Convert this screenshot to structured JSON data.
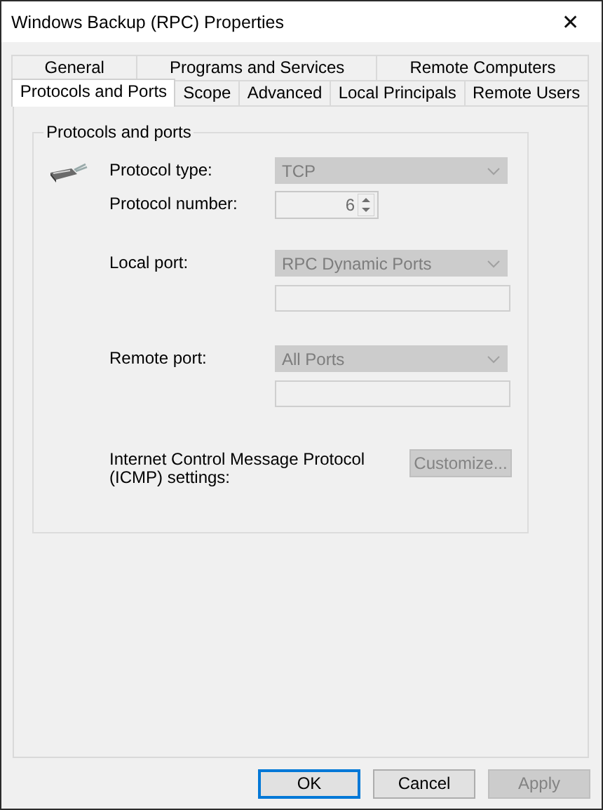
{
  "window": {
    "title": "Windows Backup (RPC) Properties",
    "close": "✕"
  },
  "tab_rows": [
    [
      {
        "label": "General",
        "selected": false
      },
      {
        "label": "Programs and Services",
        "selected": false
      },
      {
        "label": "Remote Computers",
        "selected": false
      }
    ],
    [
      {
        "label": "Protocols and Ports",
        "selected": true
      },
      {
        "label": "Scope",
        "selected": false
      },
      {
        "label": "Advanced",
        "selected": false
      },
      {
        "label": "Local Principals",
        "selected": false
      },
      {
        "label": "Remote Users",
        "selected": false
      }
    ]
  ],
  "group": {
    "title": "Protocols and ports",
    "rows": [
      {
        "label": "Protocol type:",
        "control": {
          "kind": "dropdown",
          "value": "TCP",
          "disabled": true
        }
      },
      {
        "label": "Protocol number:",
        "control": {
          "kind": "spin",
          "value": "6",
          "disabled": true
        }
      },
      {
        "label": "Local port:",
        "control": {
          "kind": "dropdown",
          "value": "RPC Dynamic Ports",
          "disabled": true
        },
        "port_box": {
          "disabled": true
        }
      },
      {
        "label": "Remote port:",
        "control": {
          "kind": "dropdown",
          "value": "All Ports",
          "disabled": true
        },
        "port_box": {
          "disabled": true
        }
      },
      {
        "label": "Internet Control Message Protocol (ICMP) settings:",
        "control": {
          "kind": "button",
          "value": "Customize...",
          "disabled": true
        }
      }
    ]
  },
  "buttons": [
    {
      "label": "OK",
      "default": true,
      "disabled": false
    },
    {
      "label": "Cancel",
      "default": false,
      "disabled": false
    },
    {
      "label": "Apply",
      "default": false,
      "disabled": true
    }
  ]
}
